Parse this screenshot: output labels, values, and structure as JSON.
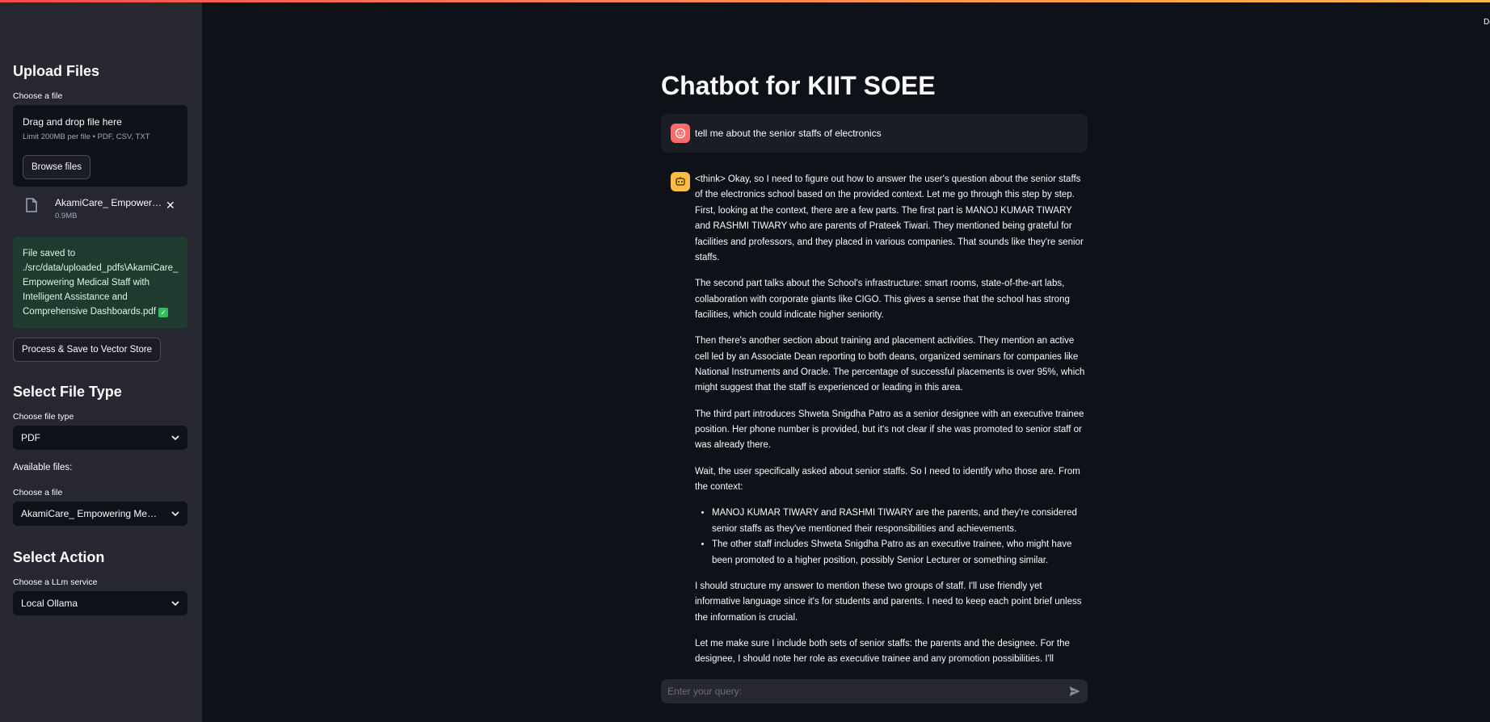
{
  "header": {
    "deploy_label": "Deploy"
  },
  "sidebar": {
    "upload": {
      "heading": "Upload Files",
      "label": "Choose a file",
      "dropzone_title": "Drag and drop file here",
      "dropzone_limit": "Limit 200MB per file • PDF, CSV, TXT",
      "browse_label": "Browse files",
      "file_name": "AkamiCare_ Empowering Medical Staff with Intelligent Assistance and Comprehensive Dashboards.pdf",
      "file_name_display": "AkamiCare_ Empowerin...",
      "file_size": "0.9MB",
      "success_lines": [
        "File saved to",
        "./src/data/uploaded_pdfs\\AkamiCare_",
        "Empowering Medical Staff with",
        "Intelligent Assistance and",
        "Comprehensive Dashboards.pdf"
      ],
      "process_label": "Process & Save to Vector Store"
    },
    "file_type": {
      "heading": "Select File Type",
      "label": "Choose file type",
      "value": "PDF",
      "available_label": "Available files:",
      "file_label": "Choose a file",
      "file_value": "AkamiCare_ Empowering Medic..."
    },
    "action": {
      "heading": "Select Action",
      "label": "Choose a LLm service",
      "value": "Local Ollama"
    }
  },
  "main": {
    "title": "Chatbot for KIIT SOEE",
    "user_message": "tell me about the senior staffs of electronics",
    "answer": {
      "p1a": "<think> Okay, so I need to figure out how to answer the user's question about the senior staffs of the electronics school based on the provided context. Let me go through this step by step.",
      "p1b": "First, looking at the context, there are a few parts. The first part is MANOJ KUMAR TIWARY and RASHMI TIWARY who are parents of Prateek Tiwari. They mentioned being grateful for facilities and professors, and they placed in various companies. That sounds like they're senior staffs.",
      "p2": "The second part talks about the School's infrastructure: smart rooms, state-of-the-art labs, collaboration with corporate giants like CIGO. This gives a sense that the school has strong facilities, which could indicate higher seniority.",
      "p3": "Then there's another section about training and placement activities. They mention an active cell led by an Associate Dean reporting to both deans, organized seminars for companies like National Instruments and Oracle. The percentage of successful placements is over 95%, which might suggest that the staff is experienced or leading in this area.",
      "p4": "The third part introduces Shweta Snigdha Patro as a senior designee with an executive trainee position. Her phone number is provided, but it's not clear if she was promoted to senior staff or was already there.",
      "p5": "Wait, the user specifically asked about senior staffs. So I need to identify who those are. From the context:",
      "li1": "MANOJ KUMAR TIWARY and RASHMI TIWARY are the parents, and they're considered senior staffs as they've mentioned their responsibilities and achievements.",
      "li2": "The other staff includes Shweta Snigdha Patro as an executive trainee, who might have been promoted to a higher position, possibly Senior Lecturer or something similar.",
      "p6": "I should structure my answer to mention these two groups of staff. I'll use friendly yet informative language since it's for students and parents. I need to keep each point brief unless the information is crucial.",
      "p7": "Let me make sure I include both sets of senior staffs: the parents and the designee. For the designee, I should note her role as executive trainee and any promotion possibilities. I'll mention the activities they organized, like seminars with big companies, which might contribute to their seniority."
    },
    "input_placeholder": "Enter your query:"
  },
  "icons": {
    "user_avatar": "smiley-face-icon",
    "bot_avatar": "robot-icon",
    "file": "file-icon",
    "close": "close-icon",
    "chevron": "chevron-down-icon",
    "send": "send-icon"
  },
  "colors": {
    "accent_red": "#ff4b4b",
    "bot_avatar": "#ffbd45",
    "user_avatar": "#ff6b6b",
    "success_bg": "#1d3b2e"
  }
}
